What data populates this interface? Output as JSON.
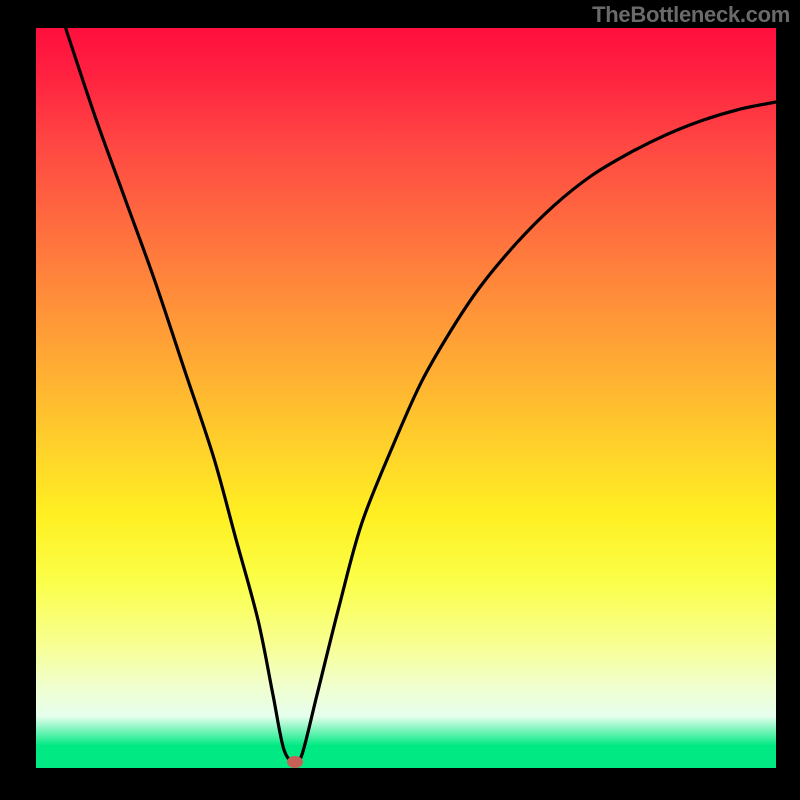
{
  "watermark": "TheBottleneck.com",
  "colors": {
    "frame_background": "#000000",
    "curve_stroke": "#000000",
    "marker_fill": "#c56057",
    "watermark_text": "#6a6a6a",
    "gradient_top": "#ff0f3d",
    "gradient_bottom": "#00e982"
  },
  "chart_data": {
    "type": "line",
    "title": "",
    "xlabel": "",
    "ylabel": "",
    "xlim": [
      0,
      100
    ],
    "ylim": [
      0,
      100
    ],
    "grid": false,
    "legend": false,
    "series": [
      {
        "name": "bottleneck-curve",
        "x": [
          4,
          8,
          12,
          16,
          20,
          24,
          27,
          30,
          32,
          33.5,
          35,
          36,
          38,
          41,
          44,
          48,
          52,
          56,
          60,
          65,
          70,
          75,
          80,
          85,
          90,
          95,
          100
        ],
        "y": [
          100,
          88,
          77,
          66,
          54,
          42,
          31,
          20,
          10,
          2.5,
          0.8,
          2,
          10,
          22,
          33,
          43,
          52,
          59,
          65,
          71,
          76,
          80,
          83,
          85.5,
          87.5,
          89,
          90
        ]
      }
    ],
    "marker": {
      "x": 35,
      "y": 0.8
    }
  }
}
